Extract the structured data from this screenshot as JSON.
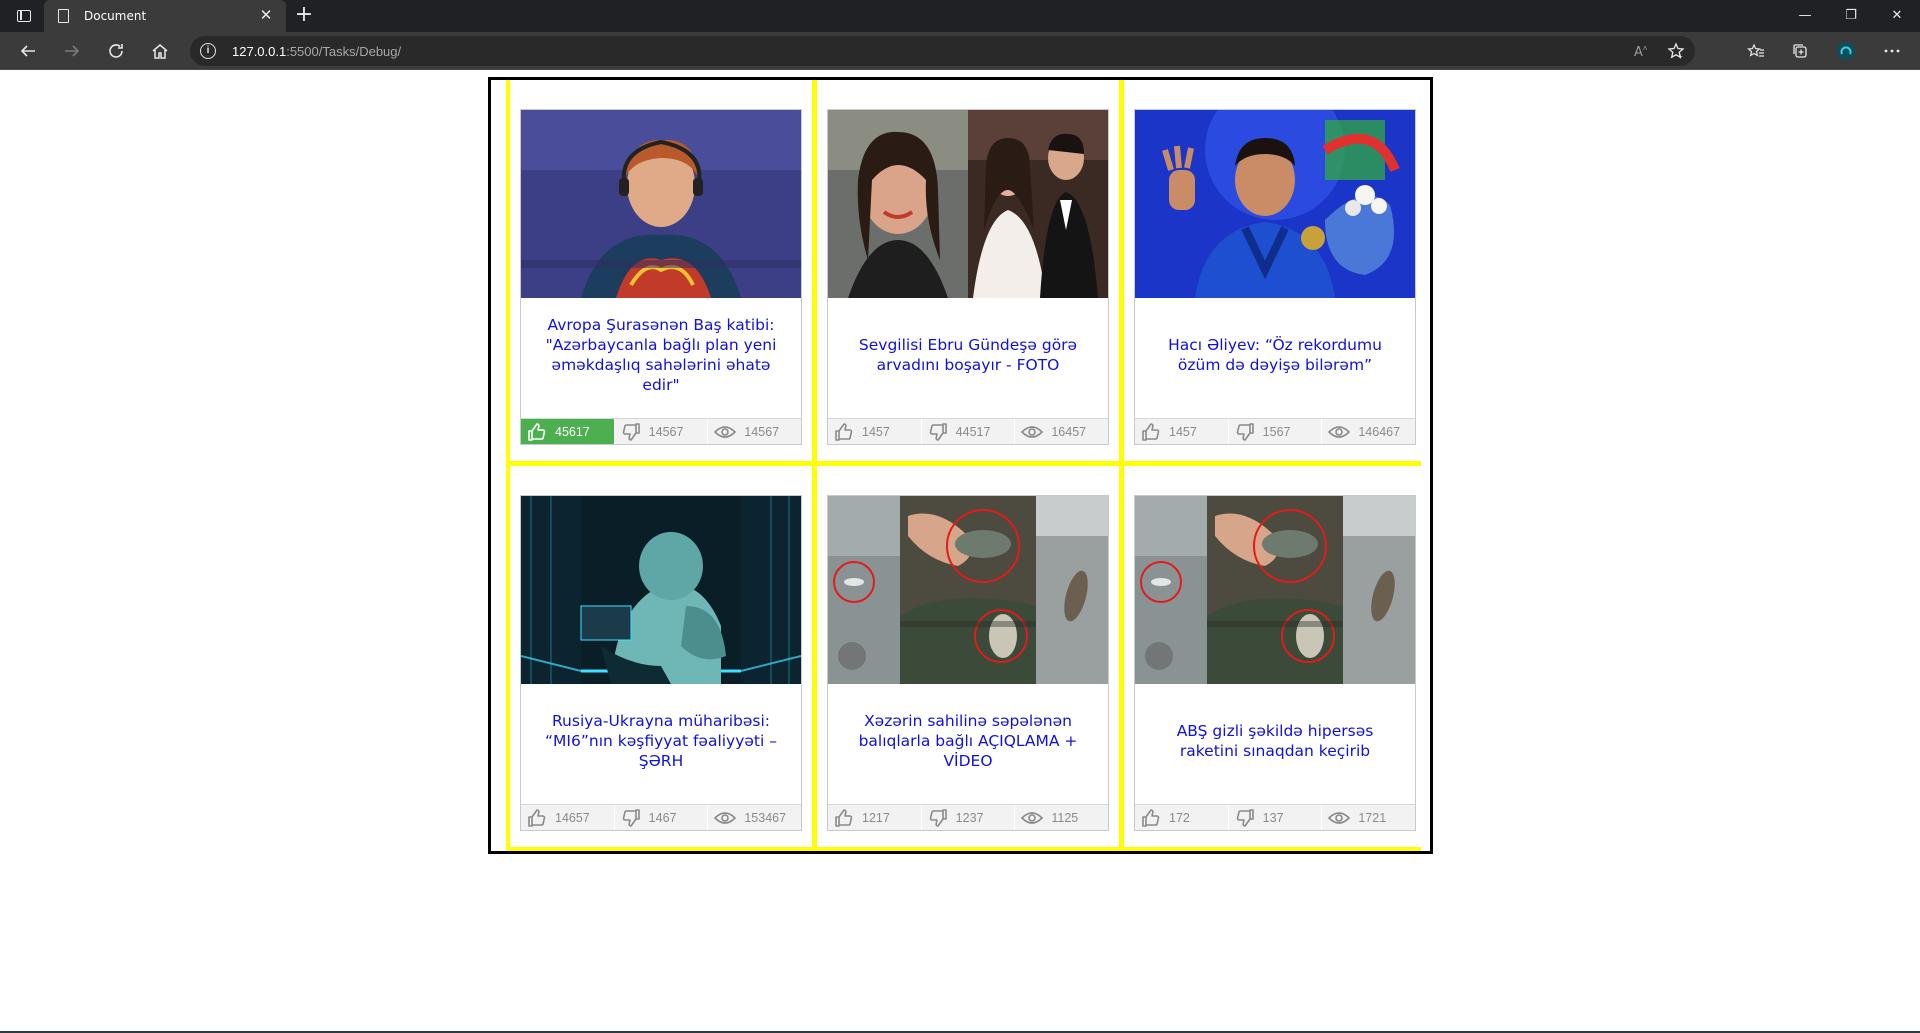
{
  "browser": {
    "tab_title": "Document",
    "url_host": "127.0.0.1",
    "url_rest": ":5500/Tasks/Debug/"
  },
  "colors": {
    "frame_border": "#000000",
    "grid_lines": "#ffff00",
    "headline": "#1111dd",
    "like_active": "#4caf50"
  },
  "cards": [
    {
      "headline": "Avropa Şurasənən Baş katibi: \"Azərbaycanla bağlı plan yeni əməkdaşlıq sahələrini əhatə edir\"",
      "likes": "45617",
      "dislikes": "14567",
      "views": "14567",
      "like_active": true,
      "image": "woman-with-headphones-photo"
    },
    {
      "headline": "Sevgilisi Ebru Gündeşə görə arvadını boşayır - FOTO",
      "likes": "1457",
      "dislikes": "44517",
      "views": "16457",
      "like_active": false,
      "image": "couple-wedding-photo"
    },
    {
      "headline": "Hacı Əliyev: “Öz rekordumu özüm də dəyişə bilərəm”",
      "likes": "1457",
      "dislikes": "1567",
      "views": "146467",
      "like_active": false,
      "image": "wrestler-with-medal-photo"
    },
    {
      "headline": "Rusiya-Ukrayna müharibəsi: “MI6”nın kəşfiyyat fəaliyyəti – ŞƏRH",
      "likes": "14657",
      "dislikes": "1467",
      "views": "153467",
      "like_active": false,
      "image": "hacker-in-server-room-photo"
    },
    {
      "headline": "Xəzərin sahilinə səpələnən balıqlarla bağlı AÇIQLAMA + VİDEO",
      "likes": "1217",
      "dislikes": "1237",
      "views": "1125",
      "like_active": false,
      "image": "dead-fish-on-shore-photo"
    },
    {
      "headline": "ABŞ gizli şəkildə hipersəs raketini sınaqdan keçirib",
      "likes": "172",
      "dislikes": "137",
      "views": "1721",
      "like_active": false,
      "image": "dead-fish-on-shore-photo"
    }
  ]
}
